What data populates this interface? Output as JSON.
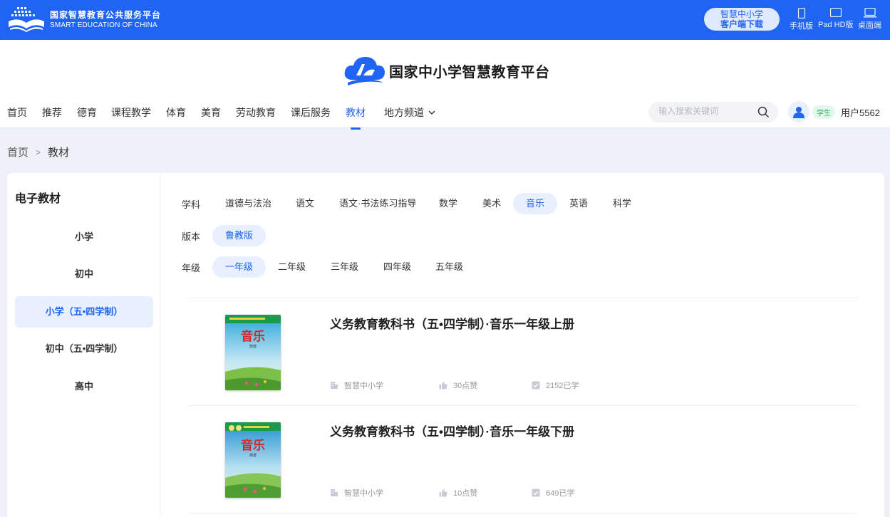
{
  "topbar": {
    "brand_cn": "国家智慧教育公共服务平台",
    "brand_en": "SMART EDUCATION OF CHINA",
    "download_line1": "智慧中小学",
    "download_line2": "客户端下载",
    "devices": [
      {
        "label": "手机版",
        "icon": "phone-icon"
      },
      {
        "label": "Pad HD版",
        "icon": "tablet-icon"
      },
      {
        "label": "桌面端",
        "icon": "desktop-icon"
      }
    ]
  },
  "header": {
    "site_title": "国家中小学智慧教育平台",
    "nav": [
      "首页",
      "推荐",
      "德育",
      "课程教学",
      "体育",
      "美育",
      "劳动教育",
      "课后服务",
      "教材",
      "地方频道"
    ],
    "active_nav": "教材",
    "search_placeholder": "输入搜索关键词",
    "role_badge": "学生",
    "username": "用户5562"
  },
  "breadcrumb": {
    "home": "首页",
    "separator": ">",
    "current": "教材"
  },
  "sidebar": {
    "title": "电子教材",
    "items": [
      "小学",
      "初中",
      "小学（五•四学制）",
      "初中（五•四学制）",
      "高中"
    ],
    "active": "小学（五•四学制）"
  },
  "filters": {
    "subject_label": "学科",
    "subjects": [
      "道德与法治",
      "语文",
      "语文·书法练习指导",
      "数学",
      "美术",
      "音乐",
      "英语",
      "科学"
    ],
    "active_subject": "音乐",
    "edition_label": "版本",
    "editions": [
      "鲁教版"
    ],
    "active_edition": "鲁教版",
    "grade_label": "年级",
    "grades": [
      "一年级",
      "二年级",
      "三年级",
      "四年级",
      "五年级"
    ],
    "active_grade": "一年级"
  },
  "books": [
    {
      "title": "义务教育教科书（五•四学制）·音乐一年级上册",
      "publisher": "智慧中小学",
      "likes": "30点赞",
      "learners": "2152已学",
      "cover_title": "音乐",
      "cover_sub": "简谱"
    },
    {
      "title": "义务教育教科书（五•四学制）·音乐一年级下册",
      "publisher": "智慧中小学",
      "likes": "10点赞",
      "learners": "649已学",
      "cover_title": "音乐",
      "cover_sub": "简谱"
    }
  ],
  "colors": {
    "primary": "#1f64f2",
    "active_bg": "#e8efff",
    "page_bg": "#eef1f8"
  }
}
